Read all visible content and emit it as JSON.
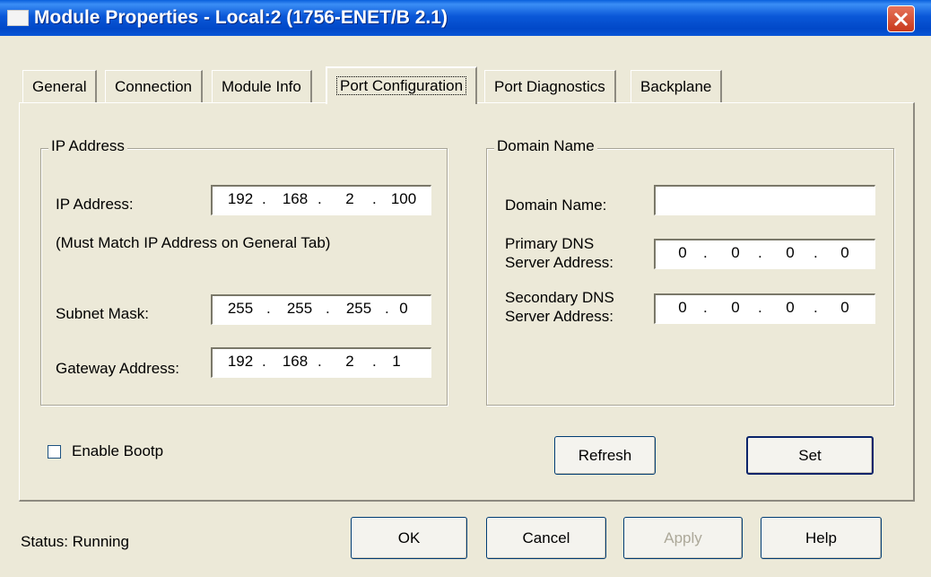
{
  "window": {
    "title": "Module Properties - Local:2 (1756-ENET/B 2.1)"
  },
  "tabs": [
    {
      "label": "General"
    },
    {
      "label": "Connection"
    },
    {
      "label": "Module Info"
    },
    {
      "label": "Port Configuration",
      "active": true
    },
    {
      "label": "Port Diagnostics"
    },
    {
      "label": "Backplane"
    }
  ],
  "ip_group": {
    "title": "IP Address",
    "ip_label": "IP Address:",
    "ip": [
      "192",
      "168",
      "2",
      "100"
    ],
    "note": "(Must Match IP Address on General Tab)",
    "subnet_label": "Subnet Mask:",
    "subnet": [
      "255",
      "255",
      "255",
      "0"
    ],
    "gateway_label": "Gateway Address:",
    "gateway": [
      "192",
      "168",
      "2",
      "1"
    ]
  },
  "domain_group": {
    "title": "Domain Name",
    "domain_label": "Domain Name:",
    "domain_value": "",
    "primary_label_1": "Primary DNS",
    "primary_label_2": "Server Address:",
    "primary": [
      "0",
      "0",
      "0",
      "0"
    ],
    "secondary_label_1": "Secondary DNS",
    "secondary_label_2": "Server Address:",
    "secondary": [
      "0",
      "0",
      "0",
      "0"
    ]
  },
  "bootp": {
    "label": "Enable Bootp",
    "checked": false
  },
  "buttons": {
    "refresh": "Refresh",
    "set": "Set",
    "ok": "OK",
    "cancel": "Cancel",
    "apply": "Apply",
    "help": "Help"
  },
  "status": {
    "text": "Status:  Running"
  },
  "icons": {
    "close": "close-icon",
    "app": "window-icon"
  }
}
